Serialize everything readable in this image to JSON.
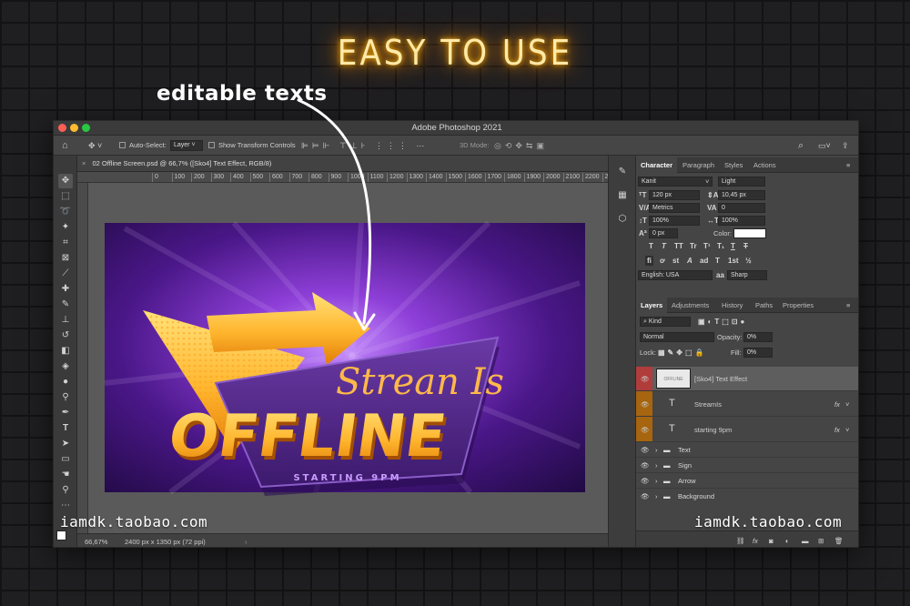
{
  "headline": "EASY TO USE",
  "annotation": "editable texts",
  "window": {
    "title": "Adobe Photoshop 2021"
  },
  "options_bar": {
    "auto_select_label": "Auto-Select:",
    "auto_select_value": "Layer",
    "transform_controls_label": "Show Transform Controls",
    "mode_3d_label": "3D Mode:"
  },
  "document": {
    "tab_label": "02 Offline Screen.psd @ 66,7% ([Sko4] Text Effect, RGB/8)",
    "ruler_ticks": [
      "0",
      "100",
      "200",
      "300",
      "400",
      "500",
      "600",
      "700",
      "800",
      "900",
      "1000",
      "1100",
      "1200",
      "1300",
      "1400",
      "1500",
      "1600",
      "1700",
      "1800",
      "1900",
      "2000",
      "2100",
      "2200",
      "2300",
      "2400"
    ],
    "zoom": "66,67%",
    "dimensions": "2400 px x 1350 px (72 ppi)"
  },
  "artwork": {
    "script_text": "Strean Is",
    "main_text": "OFFLINE",
    "sub_text": "STARTING 9PM"
  },
  "character_panel": {
    "tabs": [
      "Character",
      "Paragraph",
      "Styles",
      "Actions"
    ],
    "font_family": "Kanit",
    "font_style": "Light",
    "font_size": "120 px",
    "leading": "10,45 px",
    "kerning": "Metrics",
    "tracking": "0",
    "vertical_scale": "100%",
    "horizontal_scale": "100%",
    "baseline_shift": "0 px",
    "color_label": "Color:",
    "type_buttons": [
      "T",
      "T",
      "TT",
      "Tr",
      "T¹",
      "T₁",
      "T",
      "T"
    ],
    "opentype_buttons": [
      "ﬁ",
      "ơ",
      "st",
      "A",
      "ad",
      "T",
      "1st",
      "½"
    ],
    "language": "English: USA",
    "antialias_icon": "aa",
    "antialias": "Sharp"
  },
  "layers_panel": {
    "tabs": [
      "Layers",
      "Adjustments",
      "History",
      "Paths",
      "Properties"
    ],
    "filter_kind": "Kind",
    "blend_mode": "Normal",
    "opacity_label": "Opacity:",
    "opacity": "0%",
    "lock_label": "Lock:",
    "fill_label": "Fill:",
    "fill": "0%",
    "thumb_text": "OFFLINE",
    "fx_label": "fx",
    "layers": [
      {
        "name": "[Sko4] Text Effect",
        "kind": "smart-object",
        "color": "#b13c3c"
      },
      {
        "name": "StreamIs",
        "kind": "text",
        "color": "#a7650f"
      },
      {
        "name": "starting 9pm",
        "kind": "text",
        "color": "#a7650f"
      },
      {
        "name": "Text",
        "kind": "group"
      },
      {
        "name": "Sign",
        "kind": "group"
      },
      {
        "name": "Arrow",
        "kind": "group"
      },
      {
        "name": "Background",
        "kind": "group"
      }
    ],
    "footer_icons": [
      "link-icon",
      "fx-icon",
      "mask-icon",
      "adjustment-icon",
      "folder-icon",
      "new-layer-icon",
      "trash-icon"
    ]
  },
  "watermark": "iamdk.taobao.com"
}
